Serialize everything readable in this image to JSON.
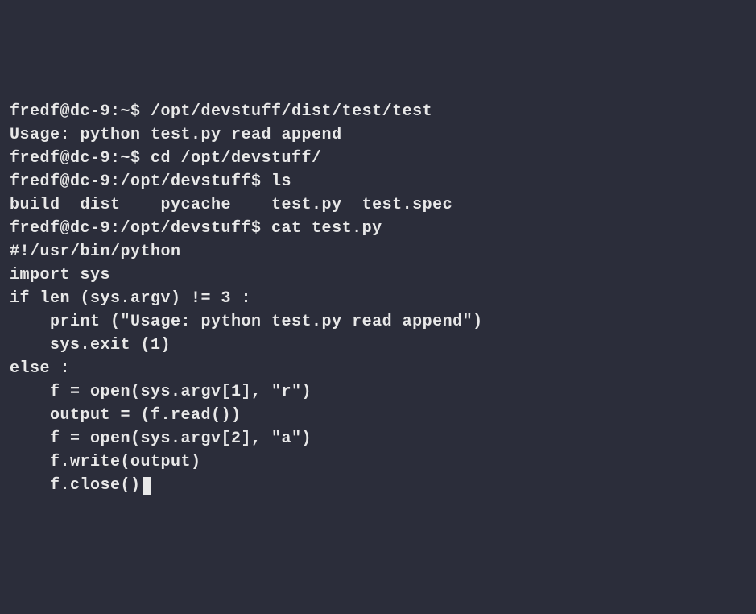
{
  "terminal": {
    "lines": [
      "fredf@dc-9:~$ /opt/devstuff/dist/test/test",
      "Usage: python test.py read append",
      "fredf@dc-9:~$ cd /opt/devstuff/",
      "fredf@dc-9:/opt/devstuff$ ls",
      "build  dist  __pycache__  test.py  test.spec",
      "fredf@dc-9:/opt/devstuff$ cat test.py",
      "#!/usr/bin/python",
      "",
      "import sys",
      "",
      "if len (sys.argv) != 3 :",
      "    print (\"Usage: python test.py read append\")",
      "    sys.exit (1)",
      "",
      "else :",
      "    f = open(sys.argv[1], \"r\")",
      "    output = (f.read())",
      "",
      "    f = open(sys.argv[2], \"a\")",
      "    f.write(output)",
      "    f.close()"
    ]
  }
}
